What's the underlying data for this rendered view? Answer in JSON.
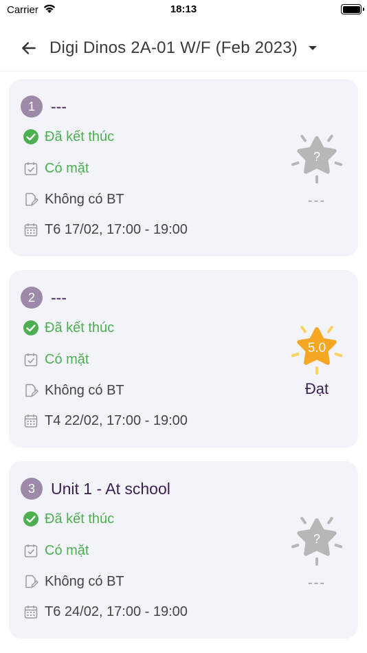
{
  "status_bar": {
    "carrier": "Carrier",
    "time": "18:13"
  },
  "header": {
    "title": "Digi Dinos 2A-01 W/F (Feb 2023)"
  },
  "sessions": [
    {
      "number": "1",
      "title": "---",
      "status": "Đã kết thúc",
      "attendance": "Có mặt",
      "homework": "Không có BT",
      "datetime": "T6 17/02, 17:00 - 19:00",
      "star_text": "?",
      "star_color": "#b7b7b7",
      "score_label": "---"
    },
    {
      "number": "2",
      "title": "---",
      "status": "Đã kết thúc",
      "attendance": "Có mặt",
      "homework": "Không có BT",
      "datetime": "T4 22/02, 17:00 - 19:00",
      "star_text": "5.0",
      "star_color": "#f5a623",
      "ray_color": "#f8d35e",
      "score_label": "Đạt"
    },
    {
      "number": "3",
      "title": "Unit 1 - At school",
      "status": "Đã kết thúc",
      "attendance": "Có mặt",
      "homework": "Không có BT",
      "datetime": "T6 24/02, 17:00 - 19:00",
      "star_text": "?",
      "star_color": "#b7b7b7",
      "score_label": "---"
    }
  ]
}
